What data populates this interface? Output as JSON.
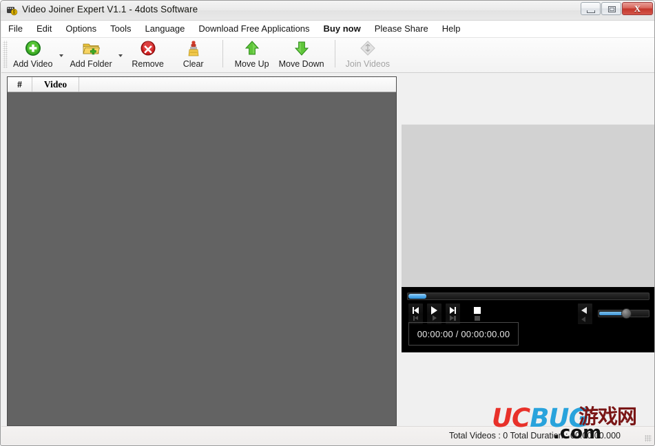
{
  "window": {
    "title": "Video Joiner Expert V1.1 - 4dots Software",
    "app_icon": "video-joiner-icon",
    "caption": {
      "minimize": "minimize-icon",
      "maximize": "maximize-icon",
      "close_glyph": "X"
    }
  },
  "menubar": {
    "items": [
      {
        "label": "File",
        "bold": false
      },
      {
        "label": "Edit",
        "bold": false
      },
      {
        "label": "Options",
        "bold": false
      },
      {
        "label": "Tools",
        "bold": false
      },
      {
        "label": "Language",
        "bold": false
      },
      {
        "label": "Download Free Applications",
        "bold": false
      },
      {
        "label": "Buy now",
        "bold": true
      },
      {
        "label": "Please Share",
        "bold": false
      },
      {
        "label": "Help",
        "bold": false
      }
    ]
  },
  "toolbar": {
    "buttons": [
      {
        "label": "Add Video",
        "icon": "add-video-icon",
        "dropdown": true,
        "disabled": false
      },
      {
        "label": "Add Folder",
        "icon": "add-folder-icon",
        "dropdown": true,
        "disabled": false
      },
      {
        "label": "Remove",
        "icon": "remove-icon",
        "dropdown": false,
        "disabled": false
      },
      {
        "label": "Clear",
        "icon": "clear-icon",
        "dropdown": false,
        "disabled": false
      },
      {
        "label": "Move Up",
        "icon": "move-up-icon",
        "dropdown": false,
        "disabled": false
      },
      {
        "label": "Move Down",
        "icon": "move-down-icon",
        "dropdown": false,
        "disabled": false
      },
      {
        "label": "Join Videos",
        "icon": "join-videos-icon",
        "dropdown": false,
        "disabled": true
      }
    ]
  },
  "video_list": {
    "columns": [
      {
        "label": "#"
      },
      {
        "label": "Video"
      }
    ],
    "rows": []
  },
  "player": {
    "time_display": "00:00:00 / 00:00:00.00",
    "seek_position_percent": 0,
    "volume_percent": 48,
    "controls": [
      {
        "name": "previous-button"
      },
      {
        "name": "play-button"
      },
      {
        "name": "next-button"
      },
      {
        "name": "stop-button"
      }
    ],
    "volume_icon": "speaker-icon"
  },
  "statusbar": {
    "text": "Total Videos : 0  Total Duration : 00:00:00.000"
  },
  "watermark": {
    "part1": "UC",
    "part2": "B",
    "part3": "UG",
    "chinese": "游戏网",
    "com": ".com"
  },
  "colors": {
    "accent_blue": "#3d94d6",
    "close_red": "#c4372c",
    "list_background": "#636363",
    "player_background": "#000000",
    "preview_background": "#d2d2d2"
  }
}
